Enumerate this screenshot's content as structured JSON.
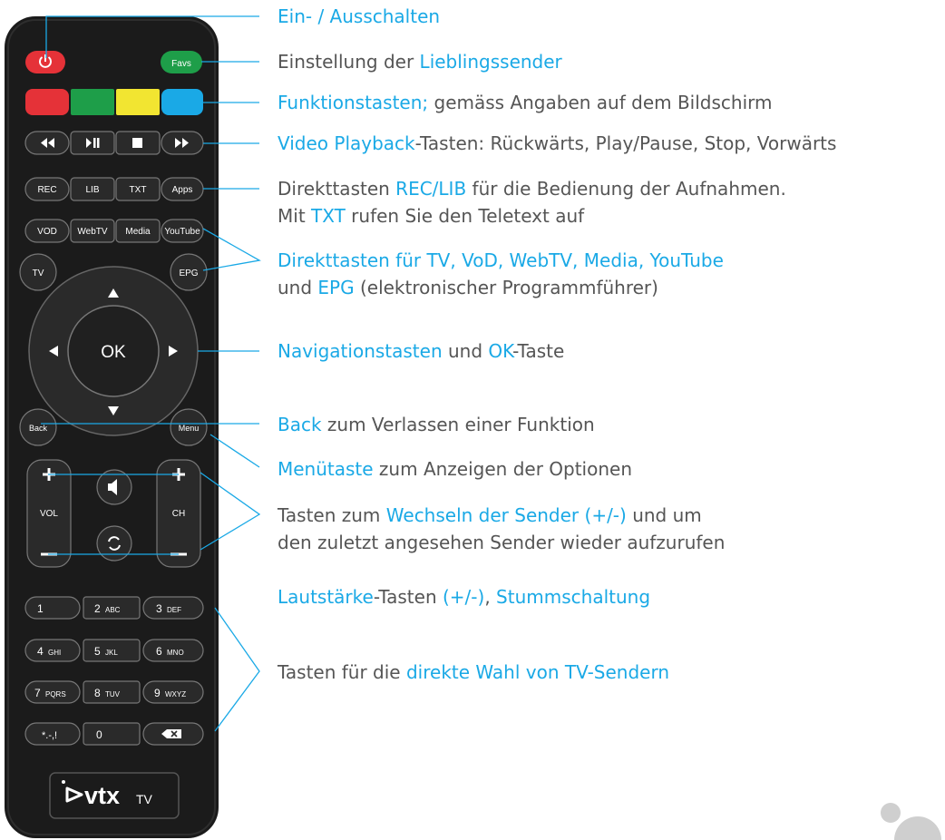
{
  "remote": {
    "brand": "vtx",
    "brand_suffix": "TV",
    "buttons": {
      "favs": "Favs",
      "rec": "REC",
      "lib": "LIB",
      "txt": "TXT",
      "apps": "Apps",
      "vod": "VOD",
      "webtv": "WebTV",
      "media": "Media",
      "youtube": "YouTube",
      "tv": "TV",
      "epg": "EPG",
      "ok": "OK",
      "back": "Back",
      "menu": "Menu",
      "vol": "VOL",
      "ch": "CH",
      "k1": "1",
      "k2": "2",
      "k2s": "ABC",
      "k3": "3",
      "k3s": "DEF",
      "k4": "4",
      "k4s": "GHI",
      "k5": "5",
      "k5s": "JKL",
      "k6": "6",
      "k6s": "MNO",
      "k7": "7",
      "k7s": "PQRS",
      "k8": "8",
      "k8s": "TUV",
      "k9": "9",
      "k9s": "WXYZ",
      "ksym": "*.-,!",
      "k0": "0"
    },
    "icons": [
      "power-icon",
      "rewind-icon",
      "play-pause-icon",
      "stop-icon",
      "fast-forward-icon",
      "up-arrow-icon",
      "down-arrow-icon",
      "left-arrow-icon",
      "right-arrow-icon",
      "mute-icon",
      "last-channel-icon",
      "backspace-icon"
    ],
    "colors": {
      "body": "#1b1b1b",
      "button": "#2a2a2a",
      "power": "#e53238",
      "favs": "#1e9e49",
      "red": "#e53238",
      "green": "#1e9e49",
      "yellow": "#f2e531",
      "blue": "#1aa9e6"
    }
  },
  "annotations": [
    {
      "id": "power",
      "parts": [
        {
          "t": "Ein- / Ausschalten",
          "h": true
        }
      ]
    },
    {
      "id": "favs",
      "parts": [
        {
          "t": "Einstellung der ",
          "h": false
        },
        {
          "t": "Lieblingssender",
          "h": true
        }
      ]
    },
    {
      "id": "function",
      "parts": [
        {
          "t": "Funktionstasten;",
          "h": true
        },
        {
          "t": " gemäss Angaben auf dem Bildschirm",
          "h": false
        }
      ]
    },
    {
      "id": "playback",
      "parts": [
        {
          "t": "Video Playback",
          "h": true
        },
        {
          "t": "-Tasten: Rückwärts, Play/Pause, Stop, Vorwärts",
          "h": false
        }
      ]
    },
    {
      "id": "rec",
      "parts": [
        {
          "t": "Direkttasten ",
          "h": false
        },
        {
          "t": "REC/LIB",
          "h": true
        },
        {
          "t": " für die Bedienung der Aufnahmen.",
          "h": false
        }
      ]
    },
    {
      "id": "txt",
      "parts": [
        {
          "t": "Mit ",
          "h": false
        },
        {
          "t": "TXT",
          "h": true
        },
        {
          "t": " rufen Sie den Teletext auf",
          "h": false
        }
      ]
    },
    {
      "id": "direct",
      "parts": [
        {
          "t": "Direkttasten für TV, VoD, WebTV, Media, YouTube",
          "h": true
        }
      ]
    },
    {
      "id": "epg",
      "parts": [
        {
          "t": "und ",
          "h": false
        },
        {
          "t": "EPG",
          "h": true
        },
        {
          "t": " (elektronischer Programmführer)",
          "h": false
        }
      ]
    },
    {
      "id": "nav",
      "parts": [
        {
          "t": "Navigationstasten",
          "h": true
        },
        {
          "t": " und ",
          "h": false
        },
        {
          "t": "OK",
          "h": true
        },
        {
          "t": "-Taste",
          "h": false
        }
      ]
    },
    {
      "id": "back",
      "parts": [
        {
          "t": "Back",
          "h": true
        },
        {
          "t": " zum Verlassen einer Funktion",
          "h": false
        }
      ]
    },
    {
      "id": "menu",
      "parts": [
        {
          "t": "Menütaste",
          "h": true
        },
        {
          "t": " zum Anzeigen der Optionen",
          "h": false
        }
      ]
    },
    {
      "id": "channel1",
      "parts": [
        {
          "t": "Tasten zum ",
          "h": false
        },
        {
          "t": "Wechseln der Sender (+/-)",
          "h": true
        },
        {
          "t": " und um",
          "h": false
        }
      ]
    },
    {
      "id": "channel2",
      "parts": [
        {
          "t": "den zuletzt angesehen Sender wieder aufzurufen",
          "h": false
        }
      ]
    },
    {
      "id": "volume",
      "parts": [
        {
          "t": "Lautstärke",
          "h": true
        },
        {
          "t": "-Tasten ",
          "h": false
        },
        {
          "t": "(+/-)",
          "h": true
        },
        {
          "t": ", ",
          "h": false
        },
        {
          "t": "Stummschaltung",
          "h": true
        }
      ]
    },
    {
      "id": "numbers",
      "parts": [
        {
          "t": "Tasten für die ",
          "h": false
        },
        {
          "t": "direkte Wahl von TV-Sendern",
          "h": true
        }
      ]
    }
  ]
}
